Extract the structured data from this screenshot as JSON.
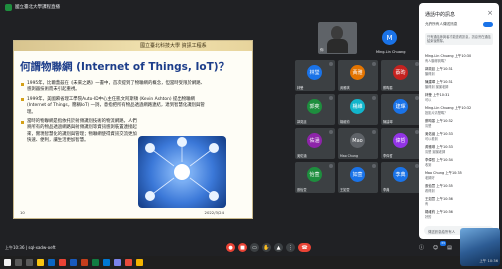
{
  "window": {
    "title": "國立臺北大學課程直播"
  },
  "slide": {
    "school": "國立臺北科技大學 資訊工程系",
    "heading": "何謂物聯網 (Internet of Things, IoT)？",
    "bullets": [
      "1995年，比爾蓋茲在《未來之路》一書中，首次提到了物聯網的概念，但當時受限於網路、感測器技術而未引起重視。",
      "1999年，美國麻省理工學院Auto-ID中心主任凱文阿斯頓 (Kevin Ashton) 提出物聯網 (Internet of Things，簡稱IoT) 一詞，意指把所有物品透過網路連結，達到智慧化識別與管理。",
      "當時的物聯網是指依托於射頻識別技術的物流網路，人們將所有的物品透過網路與射頻識別等資訊感測裝置連接起來，實現智慧化的識別與管理；物聯網使得資訊交流更加快速、便利，讓生活更加智慧。"
    ],
    "footer": "2022/3/24",
    "page": "10"
  },
  "presenter": {
    "name": "Ming-Lin Chuang",
    "initial": "M",
    "self_label": "你"
  },
  "participants": [
    {
      "name": "林瑩",
      "label": "林瑩",
      "color": "#1a73e8"
    },
    {
      "name": "黃雅",
      "label": "黃雅琪",
      "color": "#e37400"
    },
    {
      "name": "蔡昀",
      "label": "蔡昀蓁",
      "color": "#c5221f"
    },
    {
      "name": "郭奕",
      "label": "郭奕廷",
      "color": "#1e8e3e"
    },
    {
      "name": "楊維",
      "label": "楊維鈞",
      "color": "#12b5cb"
    },
    {
      "name": "建琿",
      "label": "陳建琿",
      "color": "#1a73e8"
    },
    {
      "name": "佑涵",
      "label": "吳佑涵",
      "color": "#8e24aa"
    },
    {
      "name": "Mao",
      "label": "Mao Chung",
      "color": "#5f6368"
    },
    {
      "name": "偉哲",
      "label": "李偉哲",
      "color": "#9334e6"
    },
    {
      "name": "怡萱",
      "label": "張怡萱",
      "color": "#1e8e3e"
    },
    {
      "name": "如萱",
      "label": "王如萱",
      "color": "#1a73e8"
    },
    {
      "name": "李典",
      "label": "李典",
      "color": "#1a73e8"
    }
  ],
  "chat": {
    "title": "通話中的訊息",
    "toggle_label": "允許所有人傳送訊息",
    "notice": "只有通話參與者才能查看訊息，訊息會在通話結束後刪除。",
    "messages": [
      {
        "who": "Ming-Lin Chuang 上午10:30",
        "text": "有人聽得到嗎？"
      },
      {
        "who": "郭奕廷 上午10:31",
        "text": "聽得到"
      },
      {
        "who": "陳建琿 上午10:31",
        "text": "聽得到 謝謝老師"
      },
      {
        "who": "林瑩 上午10:31",
        "text": "可以"
      },
      {
        "who": "Ming-Lin Chuang 上午10:32",
        "text": "投影片清楚嗎？"
      },
      {
        "who": "蔡昀蓁 上午10:32",
        "text": "清楚"
      },
      {
        "who": "吳佑涵 上午10:33",
        "text": "可以看到"
      },
      {
        "who": "黃雅琪 上午10:33",
        "text": "清楚 謝謝老師"
      },
      {
        "who": "李偉哲 上午10:34",
        "text": "收到"
      },
      {
        "who": "Mao Chung 上午10:35",
        "text": "老師好"
      },
      {
        "who": "張怡萱 上午10:35",
        "text": "看得到"
      },
      {
        "who": "王如萱 上午10:36",
        "text": "有"
      },
      {
        "who": "楊維鈞 上午10:36",
        "text": "好的"
      }
    ],
    "input_placeholder": "傳送訊息給所有人"
  },
  "controls": {
    "info": "上午10:36 | sql-xadw-oeft",
    "people_count": "33"
  },
  "taskbar": {
    "clock": "上午 10:36"
  }
}
